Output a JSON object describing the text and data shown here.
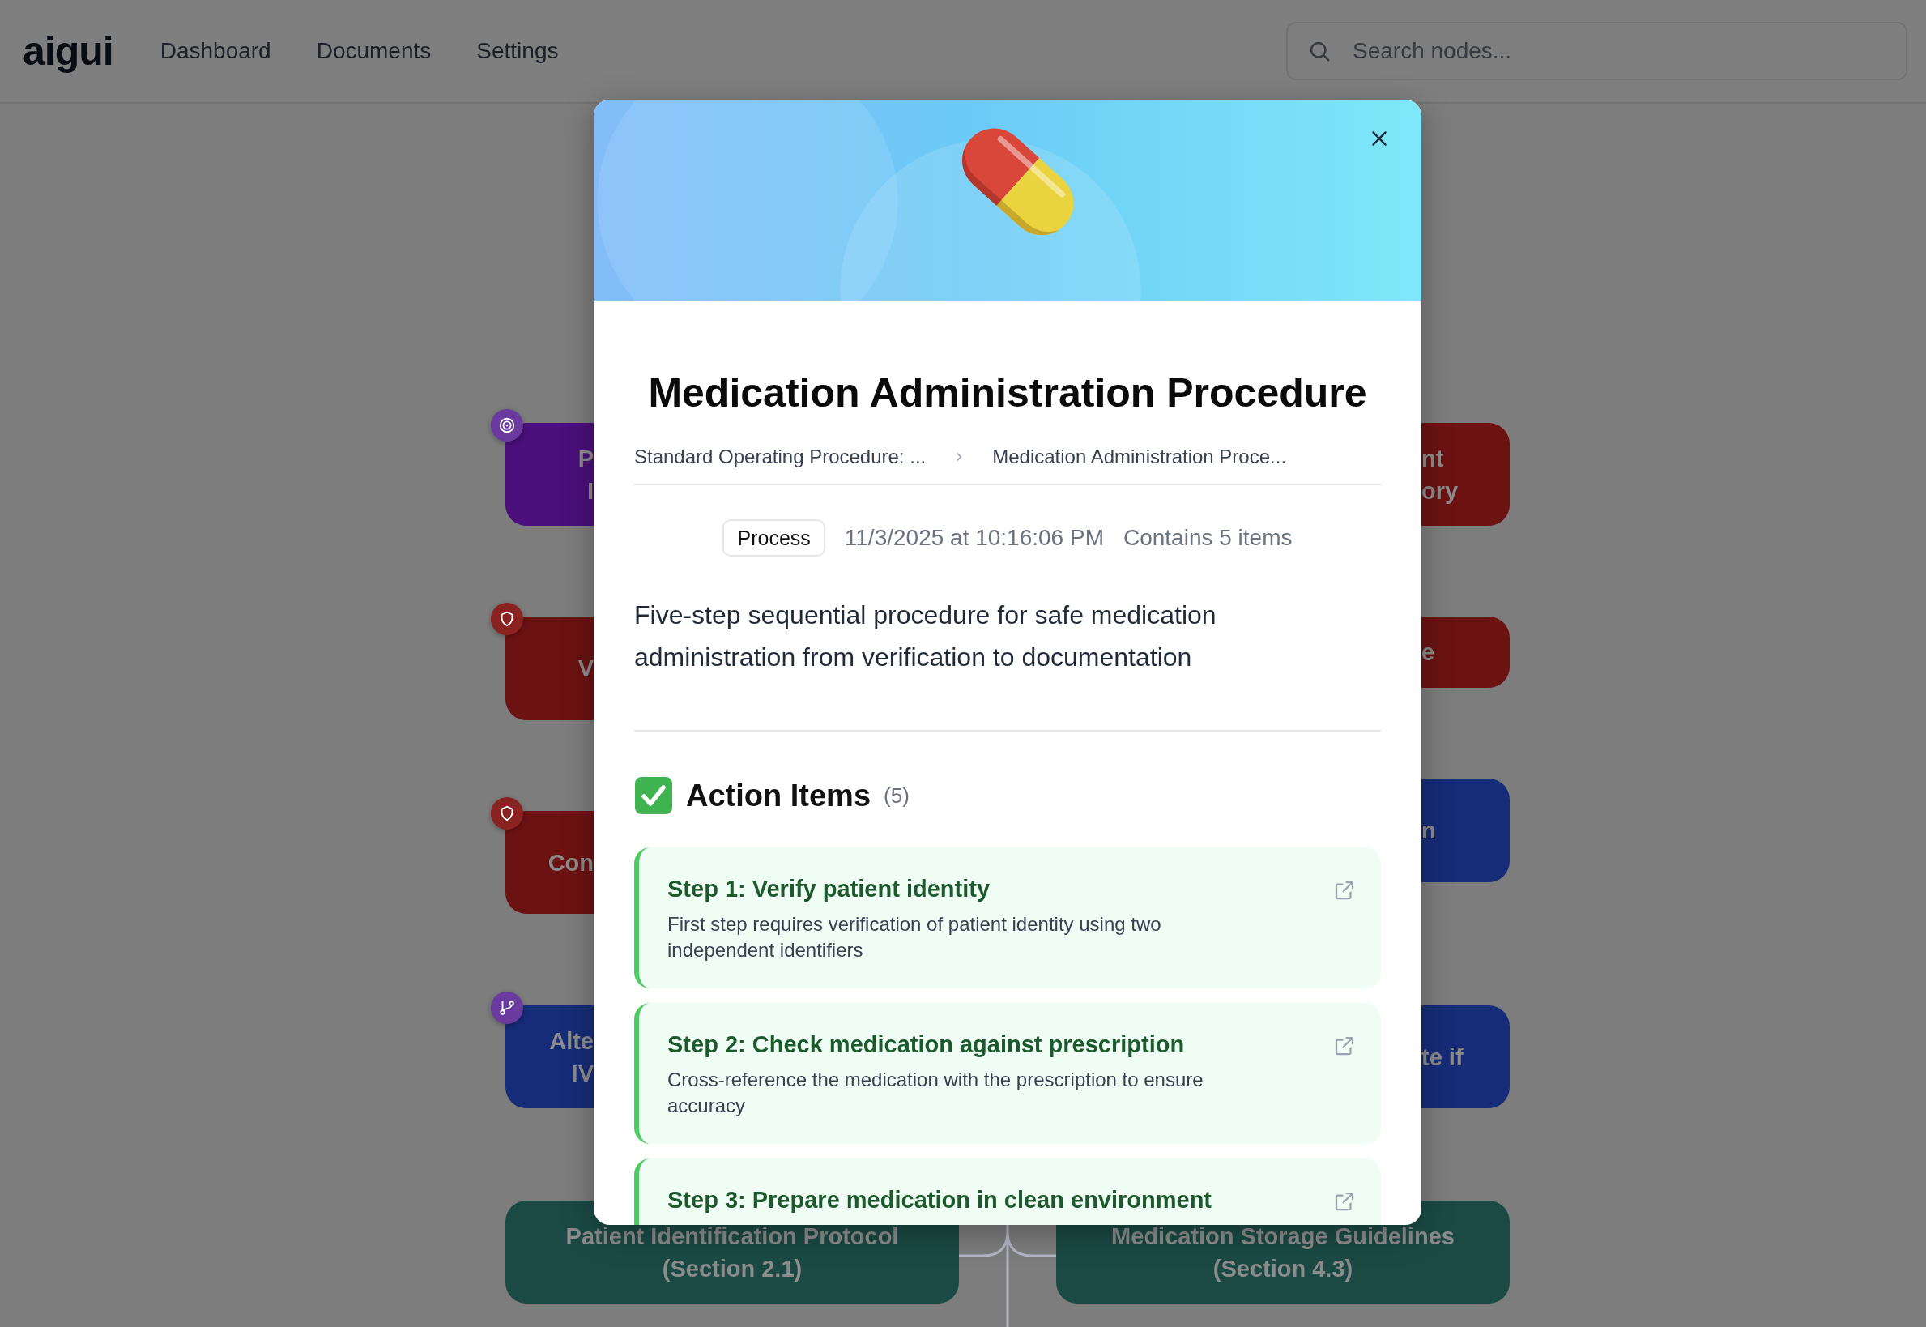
{
  "header": {
    "logo": "aigui",
    "nav": [
      "Dashboard",
      "Documents",
      "Settings"
    ],
    "search": {
      "placeholder": "Search nodes..."
    }
  },
  "canvas": {
    "left_nodes": [
      {
        "kind": "target",
        "color": "#4a0f7a",
        "lines": [
          "P",
          "I"
        ]
      },
      {
        "kind": "shield",
        "color": "#6c1212",
        "lines": [
          "V"
        ]
      },
      {
        "kind": "shield",
        "color": "#6c1212",
        "lines": [
          "Con"
        ]
      },
      {
        "kind": "branch",
        "color": "#172c78",
        "lines": [
          "Alte",
          "IV"
        ]
      },
      {
        "kind": "plain",
        "color": "#1b4a44",
        "lines": [
          "Patient Identification Protocol",
          "(Section 2.1)"
        ]
      }
    ],
    "right_nodes": [
      {
        "color": "#6c1212",
        "lines": [
          "nt",
          "ory"
        ]
      },
      {
        "color": "#6c1212",
        "lines": [
          "e"
        ]
      },
      {
        "color": "#172c78",
        "lines": [
          "n"
        ]
      },
      {
        "color": "#172c78",
        "lines": [
          "te if"
        ]
      },
      {
        "color": "#1b4a44",
        "lines": [
          "Medication Storage Guidelines",
          "(Section 4.3)"
        ]
      }
    ]
  },
  "modal": {
    "title": "Medication Administration Procedure",
    "breadcrumb": [
      "Standard Operating Procedure: ...",
      "Medication Administration Proce..."
    ],
    "type_badge": "Process",
    "timestamp": "11/3/2025 at 10:16:06 PM",
    "item_count": "Contains 5 items",
    "description": "Five-step sequential procedure for safe medication administration from verification to documentation",
    "section": {
      "title": "Action Items",
      "count": "(5)",
      "items": [
        {
          "title": "Step 1: Verify patient identity",
          "description": "First step requires verification of patient identity using two independent identifiers"
        },
        {
          "title": "Step 2: Check medication against prescription",
          "description": "Cross-reference the medication with the prescription to ensure accuracy"
        },
        {
          "title": "Step 3: Prepare medication in clean environment"
        }
      ]
    }
  }
}
